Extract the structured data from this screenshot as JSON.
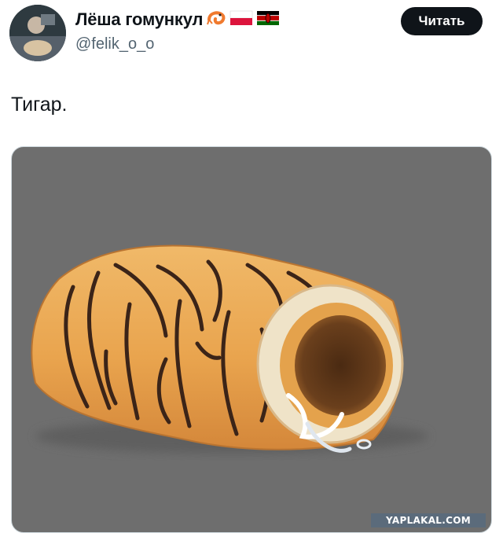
{
  "author": {
    "display_name": "Лёша гомункул",
    "handle": "@felik_o_o",
    "badges": [
      "shrimp-emoji",
      "poland-flag-emoji",
      "kenya-flag-emoji"
    ]
  },
  "follow_button": {
    "label": "Читать"
  },
  "tweet": {
    "text": "Тигар."
  },
  "media": {
    "icon": "pastry-roll-illustration",
    "background_color": "#6e6e6e"
  },
  "watermark": {
    "text": "YAPLAKAL.COM"
  },
  "colors": {
    "button_bg": "#0f1419",
    "handle_text": "#536471",
    "pastry_crust": "#e7a552",
    "pastry_stripes": "#3b2418"
  }
}
